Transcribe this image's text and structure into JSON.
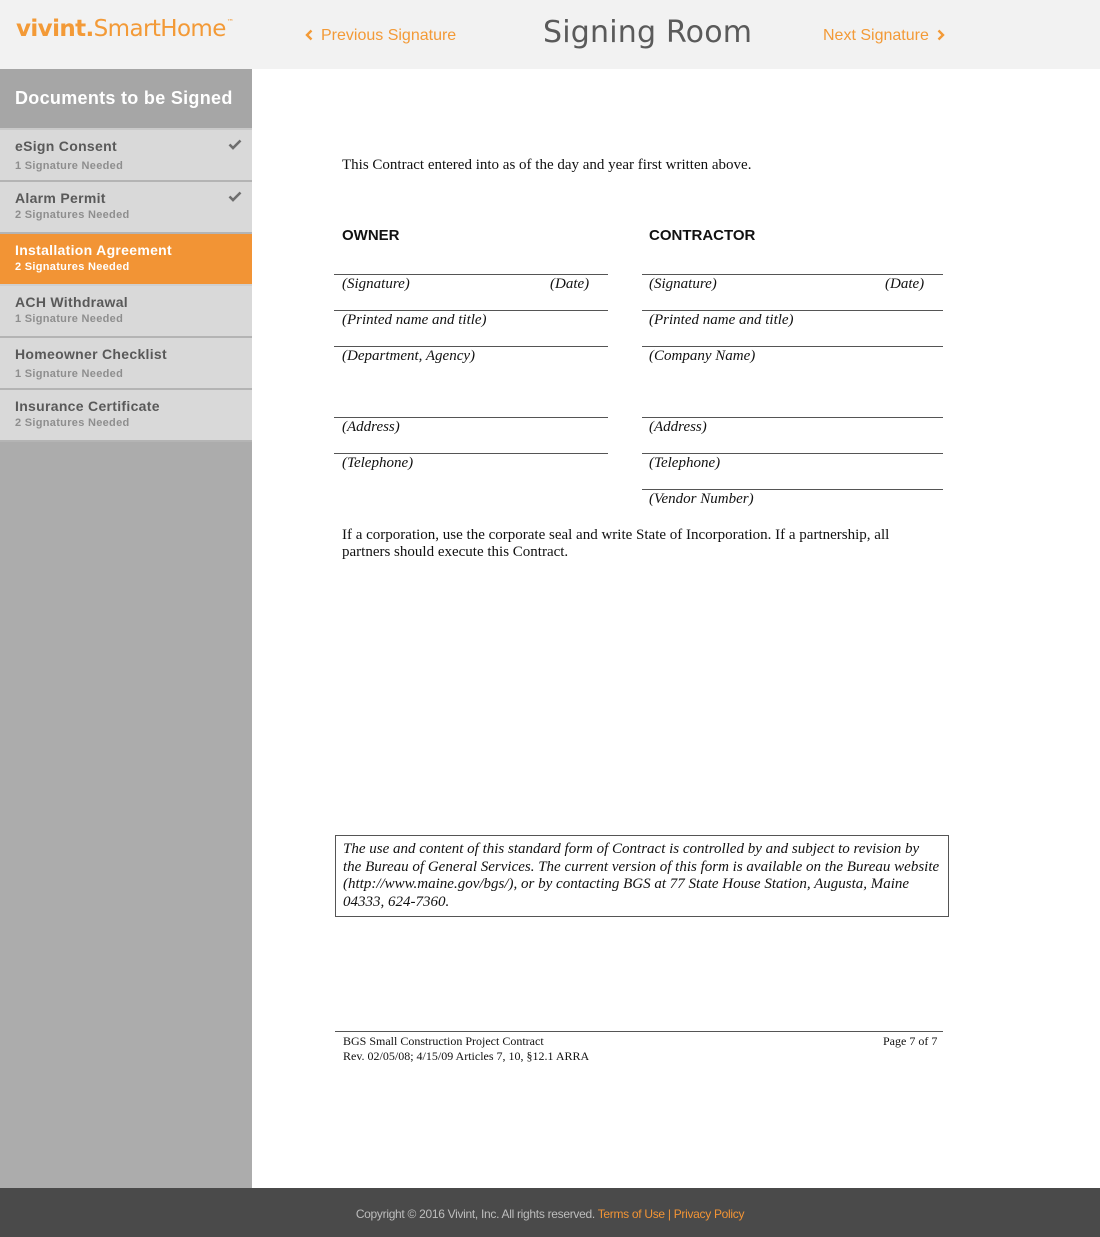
{
  "header": {
    "logo_bold": "vivint.",
    "logo_light": "SmartHome",
    "logo_tm": "™",
    "prev_label": "Previous Signature",
    "next_label": "Next Signature",
    "title": "Signing Room"
  },
  "sidebar": {
    "title": "Documents to be Signed",
    "items": [
      {
        "name": "eSign Consent",
        "sub": "1 Signature Needed",
        "completed": true,
        "active": false
      },
      {
        "name": "Alarm Permit",
        "sub": "2 Signatures Needed",
        "completed": true,
        "active": false
      },
      {
        "name": "Installation Agreement",
        "sub": "2 Signatures Needed",
        "completed": false,
        "active": true
      },
      {
        "name": "ACH Withdrawal",
        "sub": "1 Signature Needed",
        "completed": false,
        "active": false
      },
      {
        "name": "Homeowner Checklist",
        "sub": "1 Signature Needed",
        "completed": false,
        "active": false
      },
      {
        "name": "Insurance Certificate",
        "sub": "2 Signatures Needed",
        "completed": false,
        "active": false
      }
    ]
  },
  "document": {
    "intro": "This Contract entered into as of the day and year first written above.",
    "owner": {
      "heading": "OWNER",
      "signature": "(Signature)",
      "date": "(Date)",
      "printed_name": "(Printed name and title)",
      "department": "(Department, Agency)",
      "address": "(Address)",
      "telephone": "(Telephone)"
    },
    "contractor": {
      "heading": "CONTRACTOR",
      "signature": "(Signature)",
      "date": "(Date)",
      "printed_name": "(Printed name and title)",
      "company": "(Company Name)",
      "address": "(Address)",
      "telephone": "(Telephone)",
      "vendor": "(Vendor Number)"
    },
    "corporation_note": "If a corporation, use the corporate seal and write State of Incorporation.  If a partnership, all partners should execute this Contract.",
    "notice": "The use and content of this standard form of Contract is controlled by and subject to revision by the Bureau of General Services.  The current version of this form is available on the Bureau website (http://www.maine.gov/bgs/), or by contacting BGS at 77 State House Station, Augusta, Maine 04333, 624-7360.",
    "footer_line1": "BGS Small Construction Project Contract",
    "footer_line2": "Rev. 02/05/08; 4/15/09 Articles 7, 10, §12.1 ARRA",
    "page_label": "Page 7 of 7"
  },
  "footer": {
    "copyright": "Copyright © 2016 Vivint, Inc. All rights reserved. ",
    "terms": "Terms of Use",
    "separator": " | ",
    "privacy": "Privacy Policy"
  },
  "colors": {
    "accent": "#f29435",
    "header_bg": "#f2f2f2",
    "sidebar_bg": "#acacac",
    "footer_bg": "#4a4a4a"
  }
}
